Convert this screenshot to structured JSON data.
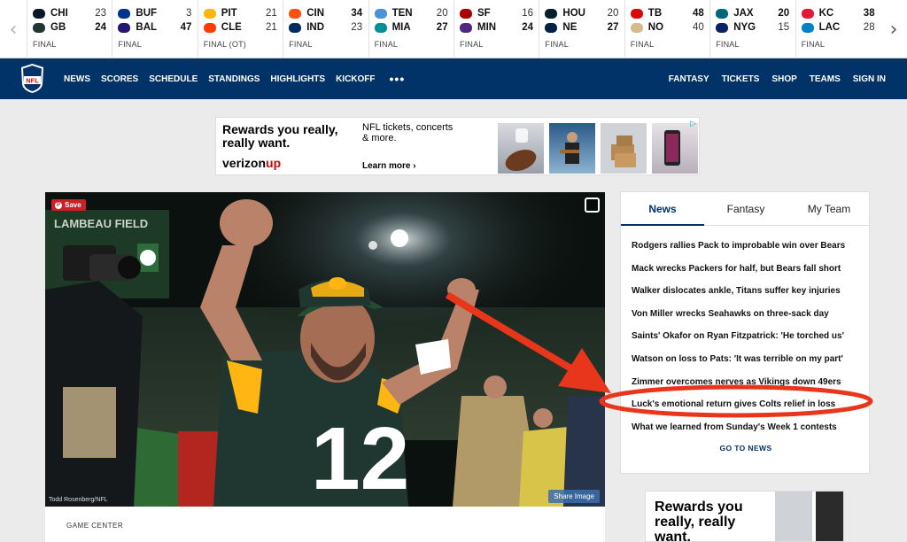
{
  "scores": {
    "games": [
      {
        "away": {
          "abbr": "CHI",
          "score": "23",
          "color": "#0b162a"
        },
        "home": {
          "abbr": "GB",
          "score": "24",
          "color": "#203731"
        },
        "status": "FINAL",
        "winner": "home"
      },
      {
        "away": {
          "abbr": "BUF",
          "score": "3",
          "color": "#00338d"
        },
        "home": {
          "abbr": "BAL",
          "score": "47",
          "color": "#241773"
        },
        "status": "FINAL",
        "winner": "home"
      },
      {
        "away": {
          "abbr": "PIT",
          "score": "21",
          "color": "#ffb612"
        },
        "home": {
          "abbr": "CLE",
          "score": "21",
          "color": "#ff3c00"
        },
        "status": "FINAL (OT)",
        "winner": "none"
      },
      {
        "away": {
          "abbr": "CIN",
          "score": "34",
          "color": "#fb4f14"
        },
        "home": {
          "abbr": "IND",
          "score": "23",
          "color": "#002c5f"
        },
        "status": "FINAL",
        "winner": "away"
      },
      {
        "away": {
          "abbr": "TEN",
          "score": "20",
          "color": "#4b92db"
        },
        "home": {
          "abbr": "MIA",
          "score": "27",
          "color": "#008e97"
        },
        "status": "FINAL",
        "winner": "home"
      },
      {
        "away": {
          "abbr": "SF",
          "score": "16",
          "color": "#aa0000"
        },
        "home": {
          "abbr": "MIN",
          "score": "24",
          "color": "#4f2683"
        },
        "status": "FINAL",
        "winner": "home"
      },
      {
        "away": {
          "abbr": "HOU",
          "score": "20",
          "color": "#03202f"
        },
        "home": {
          "abbr": "NE",
          "score": "27",
          "color": "#002244"
        },
        "status": "FINAL",
        "winner": "home"
      },
      {
        "away": {
          "abbr": "TB",
          "score": "48",
          "color": "#d50a0a"
        },
        "home": {
          "abbr": "NO",
          "score": "40",
          "color": "#d3bc8d"
        },
        "status": "FINAL",
        "winner": "away"
      },
      {
        "away": {
          "abbr": "JAX",
          "score": "20",
          "color": "#006778"
        },
        "home": {
          "abbr": "NYG",
          "score": "15",
          "color": "#0b2265"
        },
        "status": "FINAL",
        "winner": "away"
      },
      {
        "away": {
          "abbr": "KC",
          "score": "38",
          "color": "#e31837"
        },
        "home": {
          "abbr": "LAC",
          "score": "28",
          "color": "#0080c6"
        },
        "status": "FINAL",
        "winner": "away"
      }
    ]
  },
  "nav": {
    "logo_text": "NFL",
    "left": [
      "NEWS",
      "SCORES",
      "SCHEDULE",
      "STANDINGS",
      "HIGHLIGHTS",
      "KICKOFF"
    ],
    "more": "•••",
    "right": [
      "FANTASY",
      "TICKETS",
      "SHOP",
      "TEAMS",
      "SIGN IN"
    ]
  },
  "ad_top": {
    "headline": "Rewards you really, really want.",
    "copy": "NFL tickets, concerts & more.",
    "brand_a": "verizon",
    "brand_b": "up",
    "learn_more": "Learn more ›",
    "choice": "▷"
  },
  "hero": {
    "save": "Save",
    "credit": "Todd Rosenberg/NFL",
    "share": "Share Image",
    "jersey_number": "12",
    "stadium_text": "LAMBEAU FIELD"
  },
  "game_center": {
    "label": "GAME CENTER"
  },
  "news_widget": {
    "tabs": [
      "News",
      "Fantasy",
      "My Team"
    ],
    "headlines": [
      "Rodgers rallies Pack to improbable win over Bears",
      "Mack wrecks Packers for half, but Bears fall short",
      "Walker dislocates ankle, Titans suffer key injuries",
      "Von Miller wrecks Seahawks on three-sack day",
      "Saints' Okafor on Ryan Fitzpatrick: 'He torched us'",
      "Watson on loss to Pats: 'It was terrible on my part'",
      "Zimmer overcomes nerves as Vikings down 49ers",
      "Luck's emotional return gives Colts relief in loss",
      "What we learned from Sunday's Week 1 contests"
    ],
    "goto": "GO TO NEWS"
  },
  "ad_bottom": {
    "headline": "Rewards you really, really want."
  },
  "colors": {
    "nav_bg": "#013369",
    "accent_red": "#e8361c",
    "pinterest": "#cb2027"
  }
}
